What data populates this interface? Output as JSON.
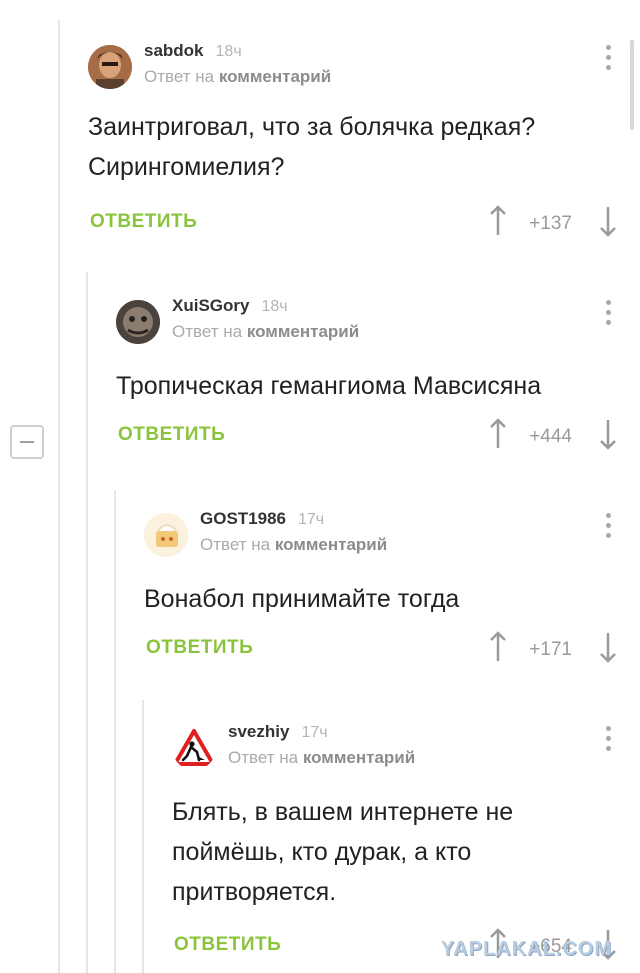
{
  "comments": [
    {
      "username": "sabdok",
      "time": "18ч",
      "reply_prefix": "Ответ на",
      "reply_target": "комментарий",
      "text": "Заинтриговал, что за болячка редкая? Сирингомиелия?",
      "reply_label": "ОТВЕТИТЬ",
      "score": "+137"
    },
    {
      "username": "XuiSGory",
      "time": "18ч",
      "reply_prefix": "Ответ на",
      "reply_target": "комментарий",
      "text": "Тропическая гемангиома Мавсисяна",
      "reply_label": "ОТВЕТИТЬ",
      "score": "+444"
    },
    {
      "username": "GOST1986",
      "time": "17ч",
      "reply_prefix": "Ответ на",
      "reply_target": "комментарий",
      "text": "Вонабол принимайте тогда",
      "reply_label": "ОТВЕТИТЬ",
      "score": "+171"
    },
    {
      "username": "svezhiy",
      "time": "17ч",
      "reply_prefix": "Ответ на",
      "reply_target": "комментарий",
      "text": "Блять, в вашем интернете не поймёшь, кто дурак, а кто притворяется.",
      "reply_label": "ОТВЕТИТЬ",
      "score": "+654"
    }
  ],
  "watermark": "YAPLAKAL.COM",
  "icons": {
    "menu": "more-vertical-icon",
    "upvote": "arrow-up-icon",
    "downvote": "arrow-down-icon",
    "collapse": "minus-icon"
  },
  "colors": {
    "reply_button": "#8ac33c",
    "muted_text": "#aaaaaa",
    "thread_line": "#e6e6e6"
  }
}
